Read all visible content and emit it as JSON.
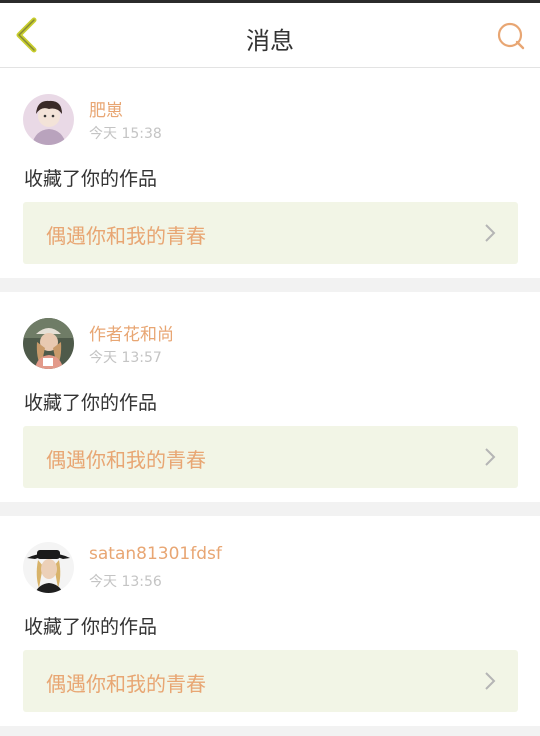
{
  "header": {
    "title": "消息",
    "back_icon": "chevron-left-icon",
    "search_icon": "search-icon",
    "accent_color": "#e8a673",
    "back_color": "#c7cd2d"
  },
  "messages": [
    {
      "user": "肥崽",
      "time": "今天 15:38",
      "action": "收藏了你的作品",
      "work_title": "偶遇你和我的青春"
    },
    {
      "user": "作者花和尚",
      "time": "今天 13:57",
      "action": "收藏了你的作品",
      "work_title": "偶遇你和我的青春"
    },
    {
      "user": "satan81301fdsf",
      "time": "今天 13:56",
      "action": "收藏了你的作品",
      "work_title": "偶遇你和我的青春"
    }
  ]
}
